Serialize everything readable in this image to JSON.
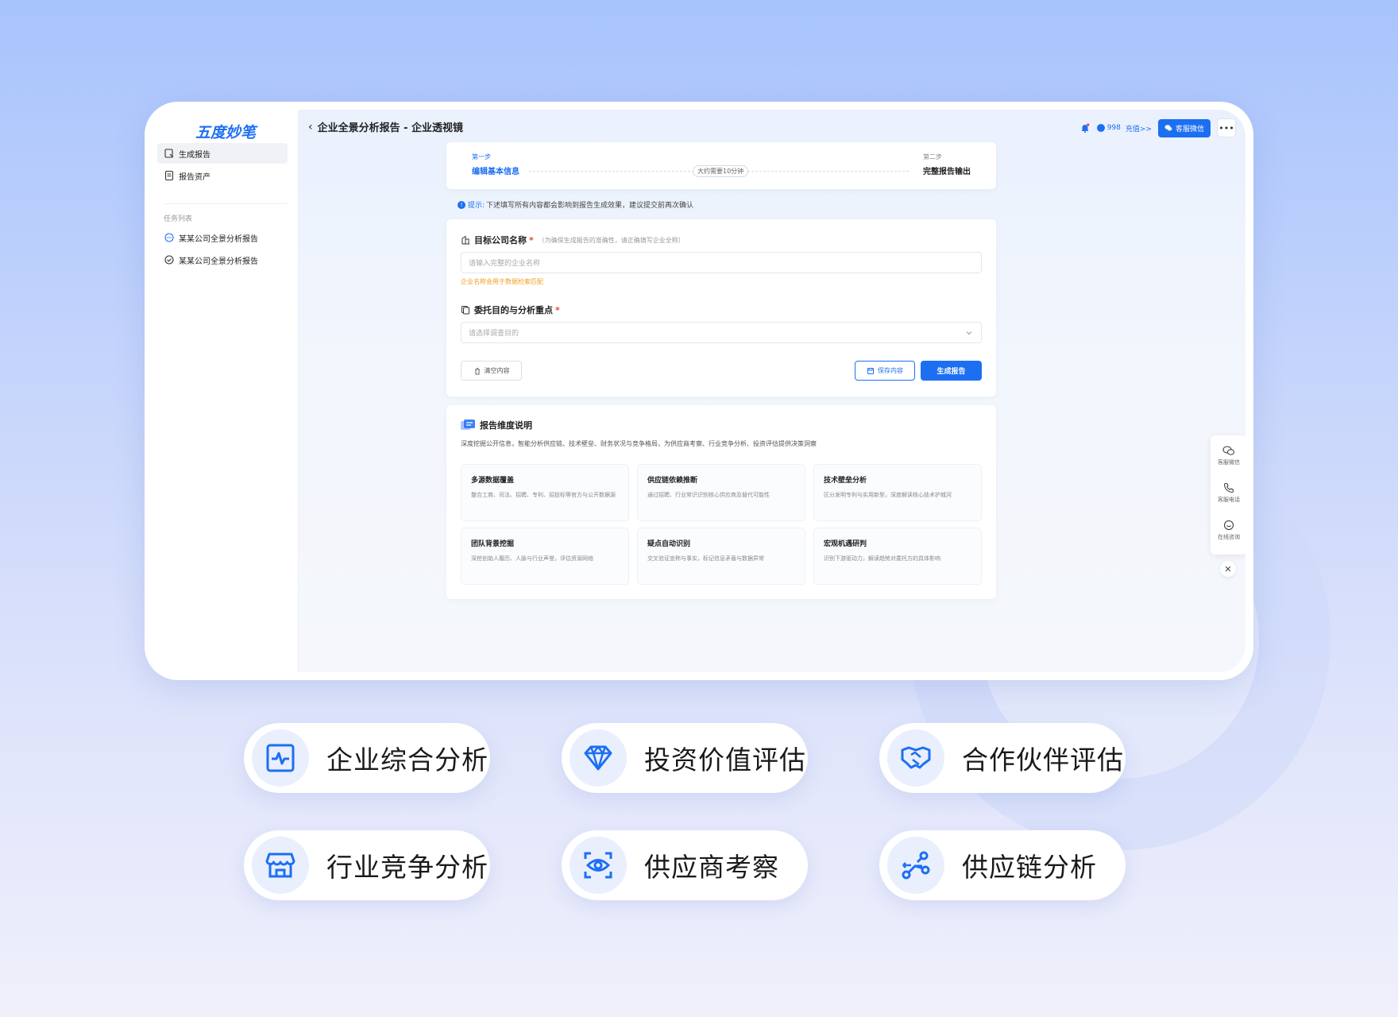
{
  "sidebar": {
    "logo": "五度妙笔",
    "items": [
      {
        "label": "生成报告",
        "icon": "generate-report-icon"
      },
      {
        "label": "报告资产",
        "icon": "report-assets-icon"
      }
    ],
    "section_title": "任务列表",
    "tasks": [
      {
        "label": "某某公司全景分析报告",
        "status_icon": "pending-icon"
      },
      {
        "label": "某某公司全景分析报告",
        "status_icon": "check-circle-icon"
      }
    ]
  },
  "header": {
    "title": "企业全景分析报告 - 企业透视镜",
    "credits": "998",
    "recharge": "充值>>",
    "service_button": "客服微信"
  },
  "steps": {
    "step1_label": "第一步",
    "step1_title": "编辑基本信息",
    "duration": "大约需要10分钟",
    "step2_label": "第二步",
    "step2_title": "完整报告输出"
  },
  "hint": {
    "label": "提示:",
    "text": "下述填写所有内容都会影响到报告生成效果，建议提交前再次确认"
  },
  "form": {
    "company_label": "目标公司名称",
    "company_note": "（为确保生成报告的准确性，请正确填写企业全称）",
    "company_placeholder": "请输入完整的企业名称",
    "company_warning": "企业名称会用于数据检索匹配",
    "purpose_label": "委托目的与分析重点",
    "purpose_placeholder": "请选择调查目的",
    "clear_button": "清空内容",
    "save_button": "保存内容",
    "generate_button": "生成报告"
  },
  "dimensions": {
    "title": "报告维度说明",
    "description": "深度挖掘公开信息，智能分析供应链、技术壁垒、财务状况与竞争格局，为供应商考察、行业竞争分析、投资评估提供决策洞察",
    "cards": [
      {
        "title": "多源数据覆盖",
        "desc": "整合工商、司法、招聘、专利、招投标等官方与公开数据源"
      },
      {
        "title": "供应链依赖推断",
        "desc": "通过招聘、行业常识识别核心供应商及替代可能性"
      },
      {
        "title": "技术壁垒分析",
        "desc": "区分发明专利与实用新型，深度解读核心技术护城河"
      },
      {
        "title": "团队背景挖掘",
        "desc": "深挖创始人履历、人脉与行业声誉，评估资源网络"
      },
      {
        "title": "疑点自动识别",
        "desc": "交叉验证宣称与事实，标记信息矛盾与数据异常"
      },
      {
        "title": "宏观机遇研判",
        "desc": "识别下游驱动力，解读趋势对委托方的具体影响"
      }
    ]
  },
  "float_panel": {
    "wechat": "客服微信",
    "phone": "客服电话",
    "online": "在线咨询"
  },
  "features": [
    {
      "label": "企业综合分析",
      "icon": "pulse-chart-icon"
    },
    {
      "label": "投资价值评估",
      "icon": "diamond-icon"
    },
    {
      "label": "合作伙伴评估",
      "icon": "handshake-icon"
    },
    {
      "label": "行业竞争分析",
      "icon": "store-icon"
    },
    {
      "label": "供应商考察",
      "icon": "eye-scan-icon"
    },
    {
      "label": "供应链分析",
      "icon": "supply-chain-icon"
    }
  ],
  "colors": {
    "accent": "#1d6ff2",
    "warning": "#f0a020",
    "required": "#e84040"
  }
}
